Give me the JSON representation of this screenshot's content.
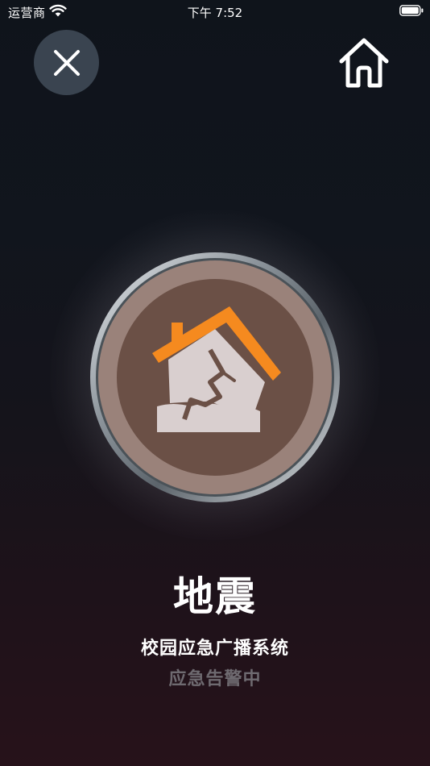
{
  "status_bar": {
    "carrier": "运营商",
    "time": "下午 7:52"
  },
  "icons": {
    "close": "close-icon",
    "home": "home-icon",
    "alert": "earthquake-house-icon",
    "wifi": "wifi-icon",
    "battery": "battery-icon"
  },
  "alert": {
    "title": "地震",
    "system_name": "校园应急广播系统",
    "status": "应急告警中"
  },
  "colors": {
    "close_button_bg": "#3a4450",
    "badge_brown": "#6b5046",
    "roof_orange": "#f58a1f",
    "house_wall": "#d9cfcf",
    "status_gray": "#6e6a70"
  }
}
